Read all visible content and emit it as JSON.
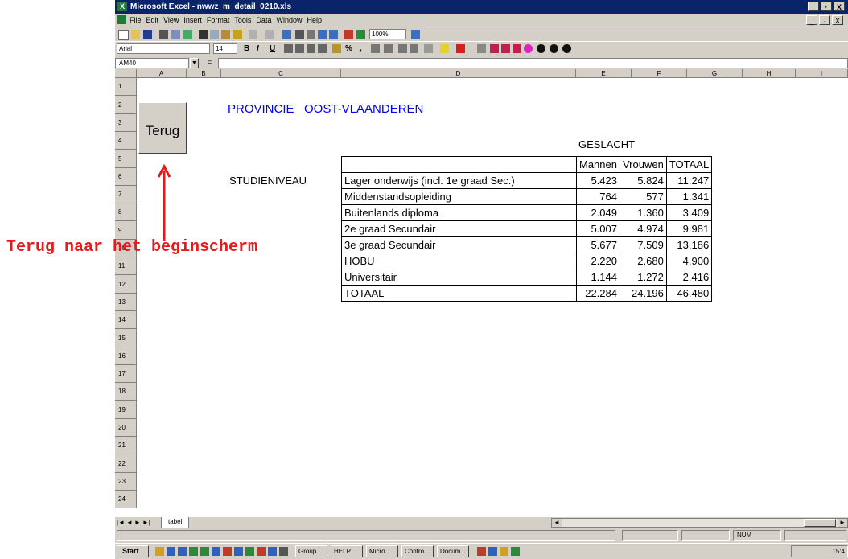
{
  "window": {
    "title": "Microsoft Excel - nwwz_m_detail_0210.xls",
    "buttons": [
      "_",
      "·",
      "X"
    ]
  },
  "menu": {
    "items": [
      "File",
      "Edit",
      "View",
      "Insert",
      "Format",
      "Tools",
      "Data",
      "Window",
      "Help"
    ],
    "mdi_buttons": [
      "_",
      "·",
      "X"
    ]
  },
  "toolbar": {
    "zoom": "100%",
    "font": "Arial",
    "font_size": "14",
    "bold": "B",
    "italic": "I",
    "underline": "U",
    "percent": "%",
    "comma": ","
  },
  "formula_bar": {
    "name_box": "AM40",
    "equals": "="
  },
  "columns": [
    "A",
    "B",
    "C",
    "D",
    "E",
    "F",
    "G",
    "H",
    "I"
  ],
  "rows": [
    "1",
    "2",
    "3",
    "4",
    "5",
    "6",
    "7",
    "8",
    "9",
    "10",
    "11",
    "12",
    "13",
    "14",
    "15",
    "16",
    "17",
    "18",
    "19",
    "20",
    "21",
    "22",
    "23",
    "24"
  ],
  "sheet": {
    "title": "PROVINCIE   OOST-VLAANDEREN",
    "button": "Terug",
    "group_header": "GESLACHT",
    "row_label": "STUDIENIVEAU",
    "col_headers": [
      "Mannen",
      "Vrouwen",
      "TOTAAL"
    ],
    "table": [
      {
        "label": "Lager onderwijs (incl. 1e graad Sec.)",
        "mannen": "5.423",
        "vrouwen": "5.824",
        "totaal": "11.247"
      },
      {
        "label": "Middenstandsopleiding",
        "mannen": "764",
        "vrouwen": "577",
        "totaal": "1.341"
      },
      {
        "label": "Buitenlands diploma",
        "mannen": "2.049",
        "vrouwen": "1.360",
        "totaal": "3.409"
      },
      {
        "label": "2e graad Secundair",
        "mannen": "5.007",
        "vrouwen": "4.974",
        "totaal": "9.981"
      },
      {
        "label": "3e graad Secundair",
        "mannen": "5.677",
        "vrouwen": "7.509",
        "totaal": "13.186"
      },
      {
        "label": "HOBU",
        "mannen": "2.220",
        "vrouwen": "2.680",
        "totaal": "4.900"
      },
      {
        "label": "Universitair",
        "mannen": "1.144",
        "vrouwen": "1.272",
        "totaal": "2.416"
      },
      {
        "label": "TOTAAL",
        "mannen": "22.284",
        "vrouwen": "24.196",
        "totaal": "46.480"
      }
    ]
  },
  "tabs": {
    "nav": [
      "|◄",
      "◄",
      "►",
      "►|"
    ],
    "sheet_tab": "tabel"
  },
  "status": {
    "num": "NUM"
  },
  "taskbar": {
    "start": "Start",
    "tasks": [
      "Group...",
      "HELP ...",
      "Micro...",
      "Contro...",
      "Docum..."
    ],
    "clock": "15:4"
  },
  "annotation": {
    "text": "Terug naar het beginscherm",
    "color": "#e8191a"
  },
  "colors": {
    "title_blue": "#0000ff",
    "titlebar": "#0a246a",
    "chrome": "#d4d0c8"
  }
}
